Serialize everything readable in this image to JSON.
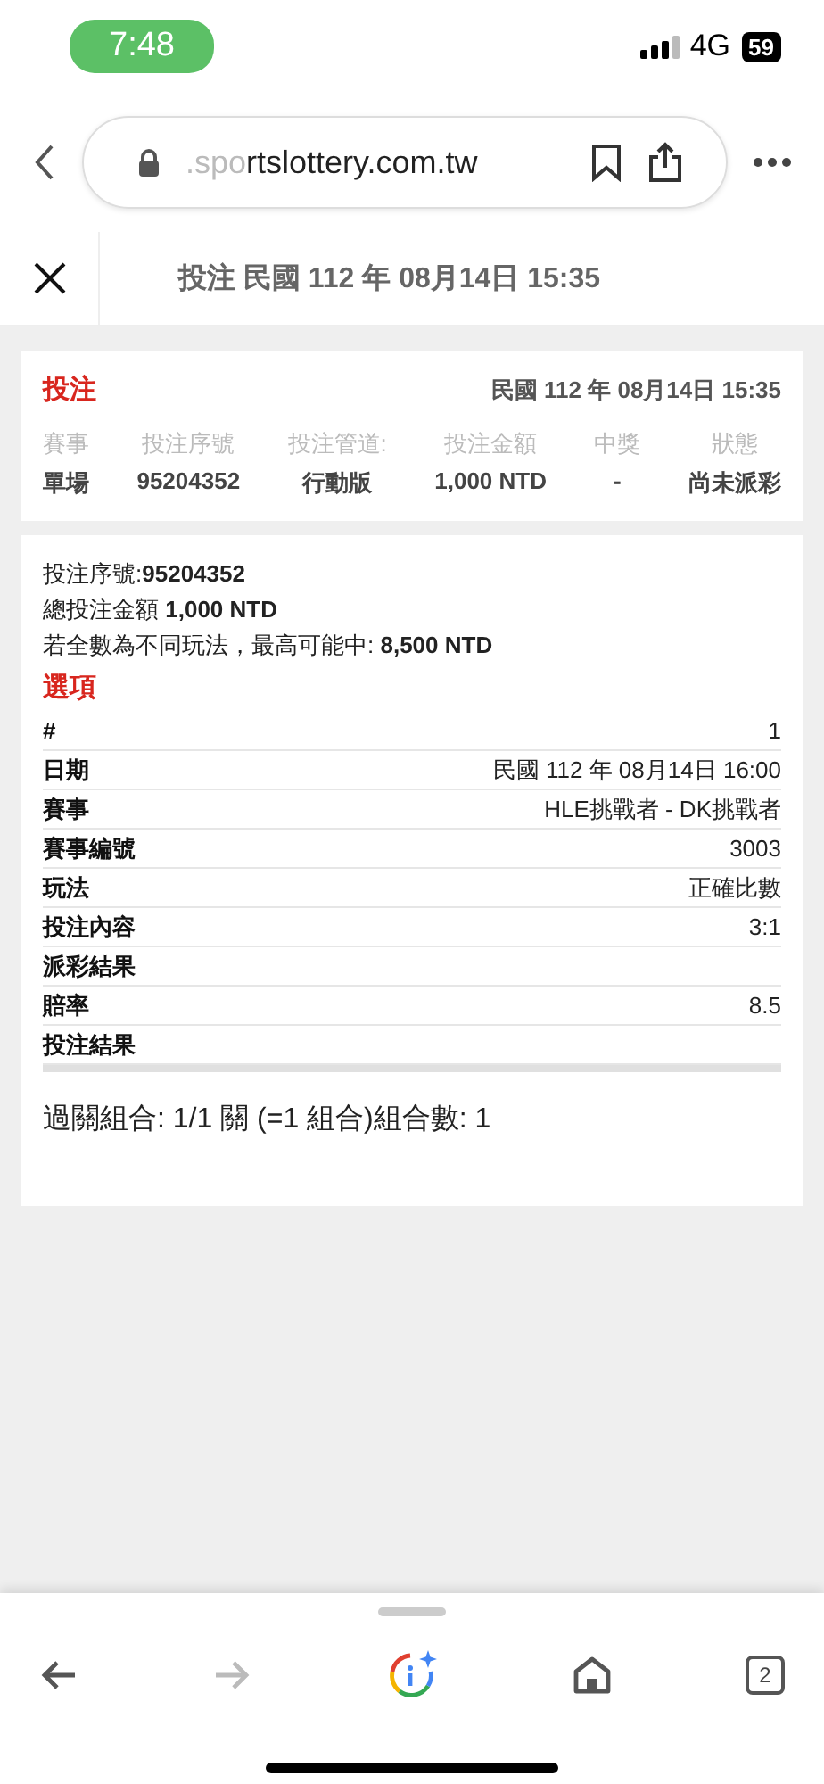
{
  "status_bar": {
    "time": "7:48",
    "network": "4G",
    "battery": "59"
  },
  "browser": {
    "url_prefix": ".spo",
    "url": "rtslottery.com.tw"
  },
  "header": {
    "title": "投注 民國 112 年 08月14日 15:35"
  },
  "summary": {
    "title": "投注",
    "datetime": "民國 112 年 08月14日 15:35",
    "columns": [
      {
        "label": "賽事",
        "value": "單場"
      },
      {
        "label": "投注序號",
        "value": "95204352"
      },
      {
        "label": "投注管道:",
        "value": "行動版"
      },
      {
        "label": "投注金額",
        "value": "1,000 NTD"
      },
      {
        "label": "中獎",
        "value": "-"
      },
      {
        "label": "狀態",
        "value": "尚未派彩"
      }
    ]
  },
  "detail": {
    "lines": [
      "投注序號:**95204352**",
      "總投注金額 **1,000 NTD**",
      "若全數為不同玩法，最高可能中: **8,500 NTD**"
    ],
    "section_title": "選項",
    "rows": [
      {
        "label": "#",
        "value": "1"
      },
      {
        "label": "日期",
        "value": "民國 112 年 08月14日 16:00"
      },
      {
        "label": "賽事",
        "value": "HLE挑戰者 - DK挑戰者"
      },
      {
        "label": "賽事編號",
        "value": "3003"
      },
      {
        "label": "玩法",
        "value": "正確比數"
      },
      {
        "label": "投注內容",
        "value": "3:1"
      },
      {
        "label": "派彩結果"
      },
      {
        "label": "賠率",
        "value": "8.5"
      },
      {
        "label": "投注結果"
      }
    ],
    "footer": "過關組合: 1/1 關 (=1 組合)組合數: 1"
  },
  "toolbar": {
    "back_disabled": false,
    "forward_disabled": true,
    "tab_count": "2"
  }
}
